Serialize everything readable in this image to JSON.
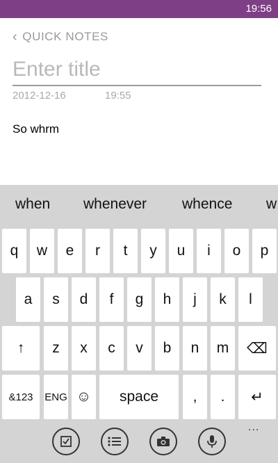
{
  "status": {
    "time": "19:56"
  },
  "nav": {
    "back_label": "QUICK NOTES"
  },
  "note": {
    "title_placeholder": "Enter title",
    "date": "2012-12-16",
    "time": "19:55",
    "body": "So whrm"
  },
  "suggestions": [
    "when",
    "whenever",
    "whence",
    "w"
  ],
  "keys": {
    "row1": [
      "q",
      "w",
      "e",
      "r",
      "t",
      "y",
      "u",
      "i",
      "o",
      "p"
    ],
    "row2": [
      "a",
      "s",
      "d",
      "f",
      "g",
      "h",
      "j",
      "k",
      "l"
    ],
    "row3": [
      "↑",
      "z",
      "x",
      "c",
      "v",
      "b",
      "n",
      "m",
      "⌫"
    ],
    "numbers": "&123",
    "lang": "ENG",
    "emoji": "☺",
    "space": "space",
    "comma": ",",
    "period": ".",
    "enter": "↵"
  },
  "appbar": {
    "icons": [
      "checklist-icon",
      "list-icon",
      "camera-icon",
      "microphone-icon"
    ],
    "more": "..."
  }
}
